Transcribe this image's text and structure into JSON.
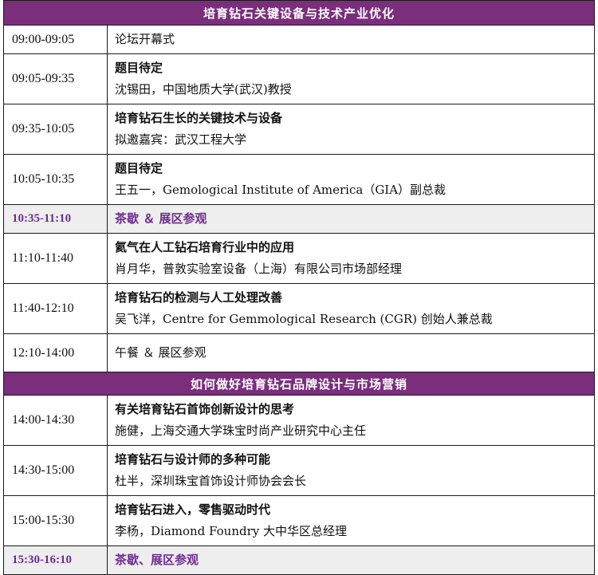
{
  "sections": [
    {
      "title": "培育钻石关键设备与技术产业优化",
      "rows": [
        {
          "time": "09:00-09:05",
          "topic": "",
          "speaker": "论坛开幕式",
          "kind": "plain"
        },
        {
          "time": "09:05-09:35",
          "topic": "题目待定",
          "speaker": "沈锡田，中国地质大学(武汉)教授",
          "kind": "talk"
        },
        {
          "time": "09:35-10:05",
          "topic": "培育钻石生长的关键技术与设备",
          "speaker": "拟邀嘉宾：武汉工程大学",
          "kind": "talk"
        },
        {
          "time": "10:05-10:35",
          "topic": "题目待定",
          "speaker": "王五一，Gemological Institute of America（GIA）副总裁",
          "kind": "talk"
        },
        {
          "time": "10:35-11:10",
          "topic": "茶歇 ＆ 展区参观",
          "speaker": "",
          "kind": "break"
        },
        {
          "time": "11:10-11:40",
          "topic": "氦气在人工钻石培育行业中的应用",
          "speaker": "肖月华，普敦实验室设备（上海）有限公司市场部经理",
          "kind": "talk"
        },
        {
          "time": "11:40-12:10",
          "topic": "培育钻石的检测与人工处理改善",
          "speaker": "吴飞洋，Centre for Gemmological Research (CGR) 创始人兼总裁",
          "kind": "talk"
        },
        {
          "time": "12:10-14:00",
          "topic": "",
          "speaker": "午餐 ＆ 展区参观",
          "kind": "plain"
        }
      ]
    },
    {
      "title": "如何做好培育钻石品牌设计与市场营销",
      "rows": [
        {
          "time": "14:00-14:30",
          "topic": "有关培育钻石首饰创新设计的思考",
          "speaker": "施健，上海交通大学珠宝时尚产业研究中心主任",
          "kind": "talk"
        },
        {
          "time": "14:30-15:00",
          "topic": "培育钻石与设计师的多种可能",
          "speaker": "杜半，深圳珠宝首饰设计师协会会长",
          "kind": "talk"
        },
        {
          "time": "15:00-15:30",
          "topic": "培育钻石进入，零售驱动时代",
          "speaker": "李杨，Diamond Foundry 大中华区总经理",
          "kind": "talk"
        },
        {
          "time": "15:30-16:10",
          "topic": "茶歇、展区参观",
          "speaker": "",
          "kind": "break"
        }
      ]
    }
  ],
  "colors": {
    "section_bg": "#7a2e7c",
    "break_text": "#6e2c8d",
    "break_bg": "#eeeeee"
  }
}
